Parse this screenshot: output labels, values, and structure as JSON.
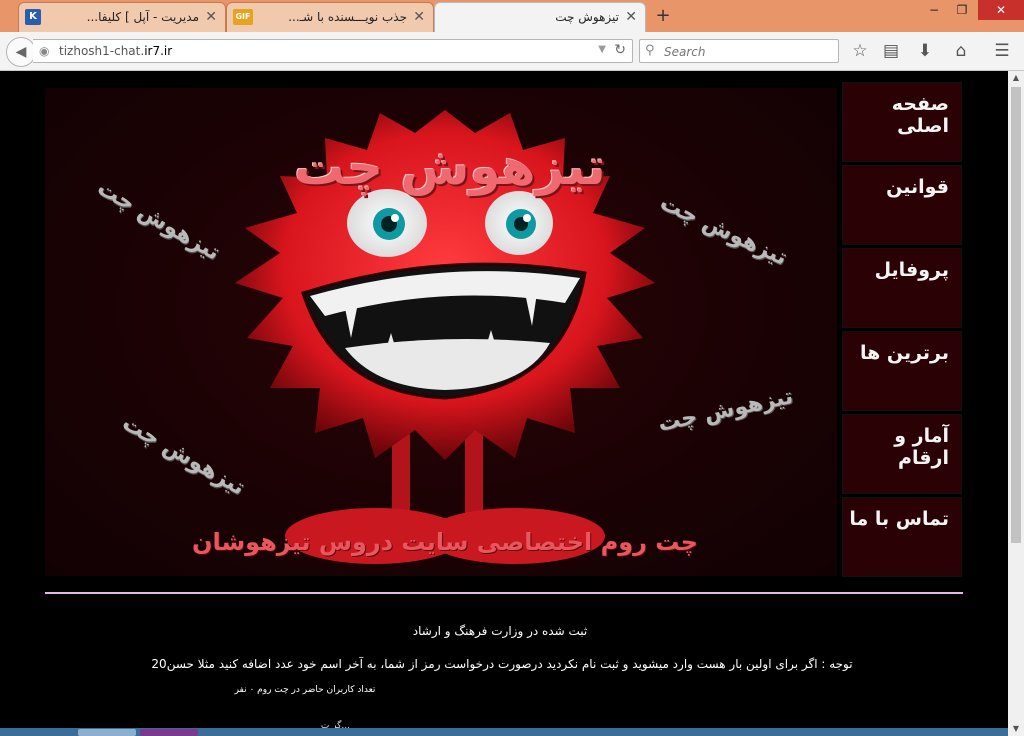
{
  "browser": {
    "tabs": [
      {
        "title": "مدیریت - آپل ] کلیفا...",
        "favicon": "K",
        "favicon_color": "#2a5db0",
        "active": false
      },
      {
        "title": "جذب نویـــسنده با شـ...",
        "favicon": "GIF",
        "favicon_color": "#e7a21f",
        "active": false
      },
      {
        "title": "تیزهوش چت",
        "favicon": "",
        "favicon_color": "",
        "active": true
      }
    ],
    "new_tab_label": "+",
    "window_controls": {
      "minimize": "−",
      "maximize": "❐",
      "close": "✕"
    },
    "url_host_prefix": "tizhosh1-chat.",
    "url_host_main": "ir7.ir",
    "search_placeholder": "Search",
    "icons": {
      "back": "back-arrow-icon",
      "globe": "globe-icon",
      "reload": "reload-icon",
      "search": "search-icon",
      "bookmark_star": "star-icon",
      "reading_list": "reading-list-icon",
      "downloads": "download-icon",
      "home": "home-icon",
      "menu": "hamburger-menu-icon"
    }
  },
  "site": {
    "banner": {
      "title": "تیزهوش چت",
      "subtitle": "چت روم اختصاصی سایت دروس تیزهوشان",
      "watermarks": [
        "تیزهوش چت",
        "تیزهوش چت",
        "تیزهوش چت",
        "تیزهوش چت"
      ]
    },
    "menu": [
      {
        "label": "صفحه اصلی"
      },
      {
        "label": "قوانین"
      },
      {
        "label": "پروفایل"
      },
      {
        "label": "برترین ها"
      },
      {
        "label": "آمار و ارقام"
      },
      {
        "label": "تماس با ما"
      }
    ],
    "registered_text": "ثبت شده در وزارت فرهنگ و ارشاد",
    "notice_text": "توجه : اگر برای اولین بار هست وارد میشوید و ثبت نام نکردید درصورت درخواست رمز از شما، به آخر اسم خود عدد اضافه کنید مثلا حسن20",
    "online_users_text": "تعداد کاربران حاضر در چت روم ۰ نفر",
    "cut_off_text": "...گر ت"
  },
  "colors": {
    "tabbar_bg": "#e8956a",
    "page_bg": "#000000",
    "menu_bg": "#2a0104",
    "divider": "#e7b7e7",
    "monster_red": "#d8151d"
  }
}
